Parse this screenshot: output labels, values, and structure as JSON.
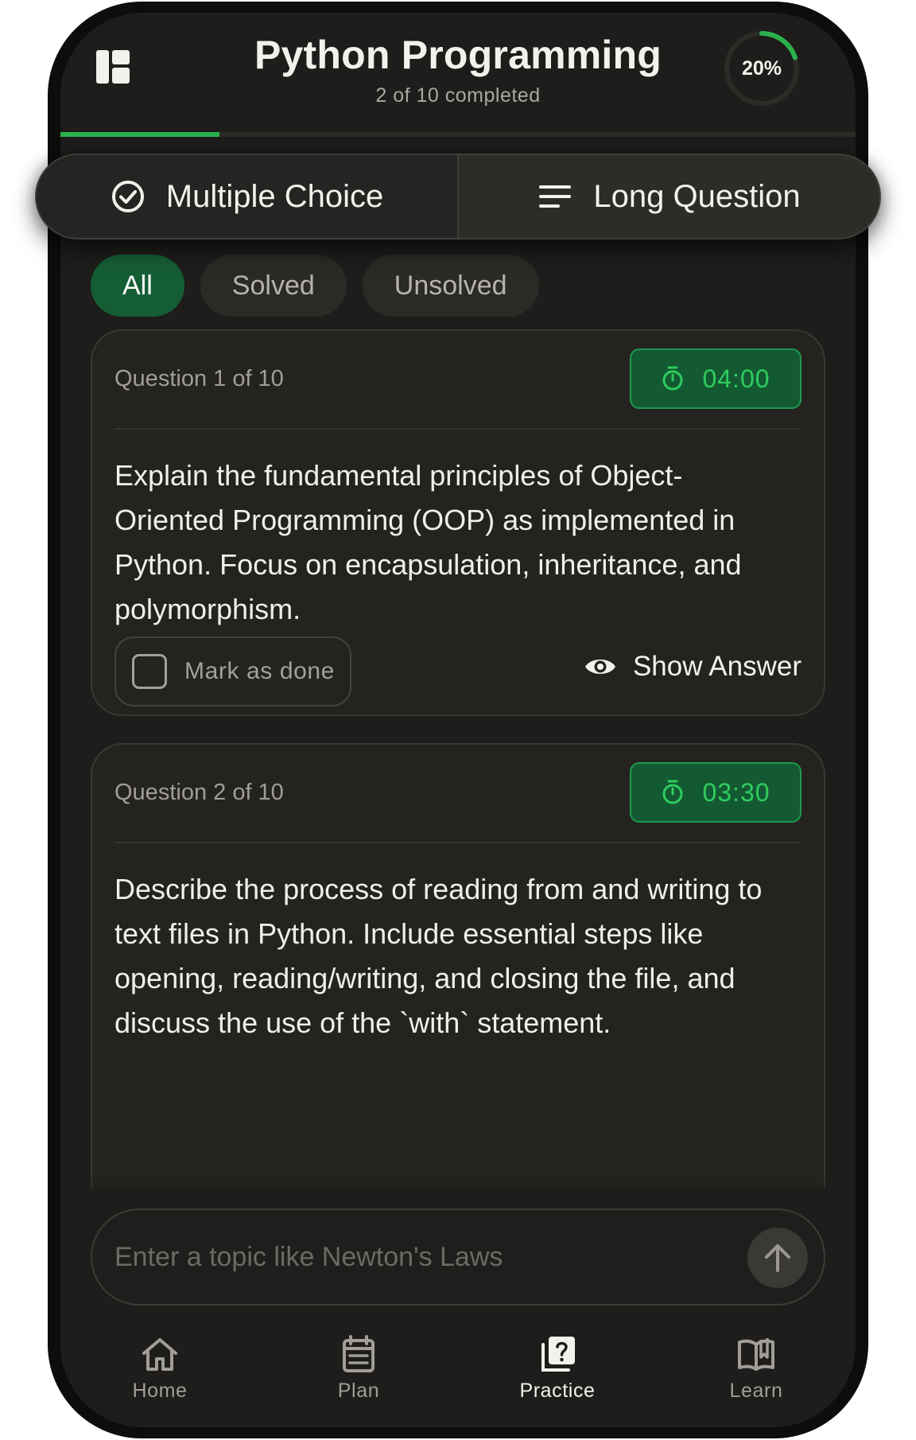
{
  "header": {
    "title": "Python Programming",
    "subtitle": "2 of 10 completed",
    "progress_label": "20%",
    "progress_fraction": 0.2,
    "menu_icon": "layout-grid-icon"
  },
  "tabs": [
    {
      "label": "Multiple Choice",
      "icon": "check-circle-icon",
      "active": true
    },
    {
      "label": "Long Question",
      "icon": "lines-icon",
      "active": false
    }
  ],
  "filters": [
    {
      "label": "All",
      "active": true
    },
    {
      "label": "Solved",
      "active": false
    },
    {
      "label": "Unsolved",
      "active": false
    }
  ],
  "questions": [
    {
      "number": "Question 1 of 10",
      "timer": "04:00",
      "text": "Explain the fundamental principles of Object-Oriented Programming (OOP) as implemented in Python. Focus on encapsulation, inheritance, and polymorphism.",
      "mark_label": "Mark as done",
      "show_label": "Show Answer"
    },
    {
      "number": "Question 2 of 10",
      "timer": "03:30",
      "text": "Describe the process of reading from and writing to text files in Python. Include essential steps like opening, reading/writing, and closing the file, and discuss the use of the `with` statement."
    }
  ],
  "input": {
    "placeholder": "Enter a topic like Newton's Laws",
    "value": ""
  },
  "nav": [
    {
      "label": "Home",
      "icon": "home-icon",
      "active": false
    },
    {
      "label": "Plan",
      "icon": "calendar-icon",
      "active": false
    },
    {
      "label": "Practice",
      "icon": "question-card-icon",
      "active": true
    },
    {
      "label": "Learn",
      "icon": "open-book-icon",
      "active": false
    }
  ],
  "colors": {
    "accent": "#2bb24c",
    "background": "#1e1d1b",
    "timer_bg": "#135a33"
  }
}
